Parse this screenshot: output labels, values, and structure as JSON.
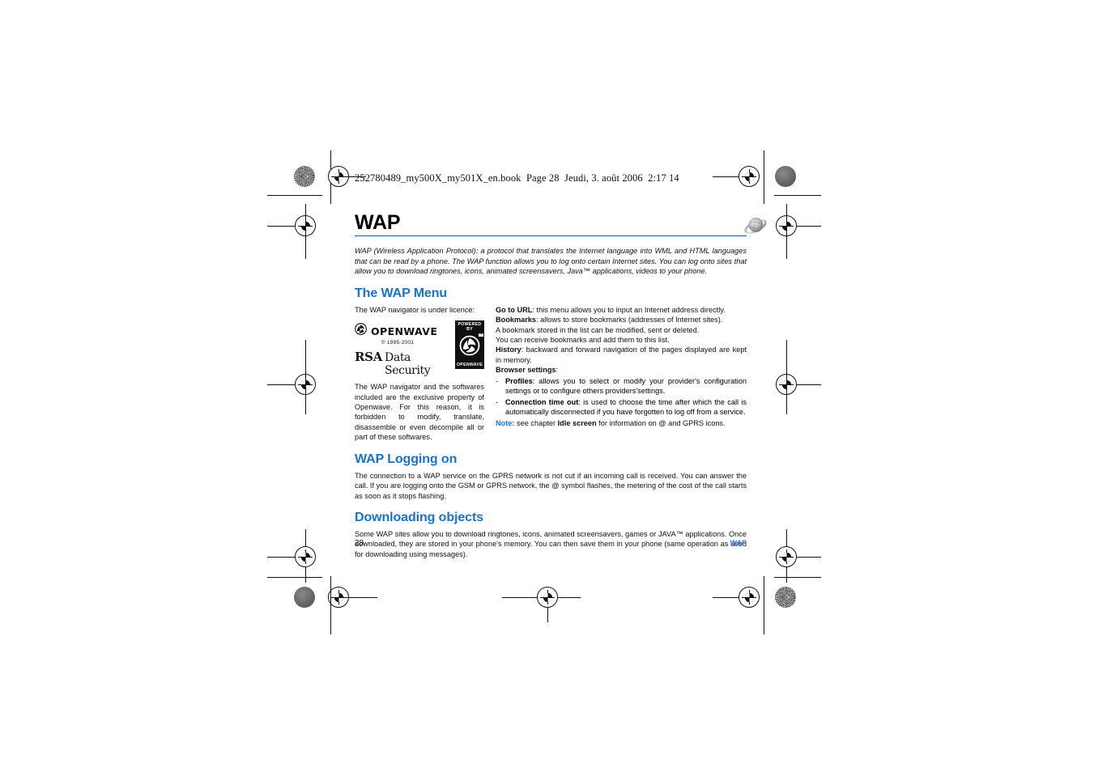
{
  "book_line": "252780489_my500X_my501X_en.book  Page 28  Jeudi, 3. août 2006  2:17 14",
  "header": {
    "title": "WAP",
    "icon": "globe-icon",
    "rule_color": "#0a5bbd"
  },
  "intro": "WAP (Wireless Application Protocol): a protocol that translates the Internet language into WML and HTML languages that can be read by a phone. The WAP function allows you to log onto certain Internet sites. You can log onto sites that allow you to download ringtones, icons, animated screensavers, Java™ applications, videos to your phone.",
  "sections": [
    {
      "id": "wap-menu",
      "heading": "The WAP Menu"
    },
    {
      "id": "wap-logging-on",
      "heading": "WAP Logging on"
    },
    {
      "id": "downloading-objects",
      "heading": "Downloading objects"
    }
  ],
  "wap_menu": {
    "left": {
      "licence_line": "The WAP navigator is under licence:",
      "openwave_word": "OPENWAVE",
      "openwave_copyright": "© 1995-2001",
      "rsa_bold": "RSA",
      "rsa_rest": "Data Security",
      "badge_top": "POWERED BY",
      "badge_tm": "™",
      "badge_bottom": "OPENWAVE",
      "paragraph": "The WAP navigator and the softwares included are the exclusive property of Openwave. For this reason, it is forbidden to modify, translate, disassemble or even decompile all or part of these softwares."
    },
    "right": {
      "items": [
        {
          "term": "Go to URL",
          "sep": ": ",
          "text": "this menu allows you to input an Internet address directly."
        },
        {
          "term": "Bookmarks",
          "sep": ": ",
          "text": "allows to store bookmarks (addresses of Internet sites)."
        }
      ],
      "plain_lines": [
        "A bookmark stored in the list can be modified, sent or deleted.",
        "You can receive bookmarks and add them to this list."
      ],
      "history": {
        "term": "History",
        "sep": ": ",
        "text": "backward and forward navigation of the pages displayed are kept in memory."
      },
      "browser_settings_label": "Browser settings",
      "browser_settings_colon": ":",
      "bullets": [
        {
          "dash": "-",
          "term": "Profiles",
          "sep": ": ",
          "text": "allows you to select or modify your provider's configuration settings or to configure others providers'settings."
        },
        {
          "dash": "-",
          "term": "Connection time out",
          "sep": ": ",
          "text": "is used to choose the time after which the call is automatically disconnected if you have forgotten to log off from a service."
        }
      ],
      "note": {
        "label": "Note:",
        "pre": " see chapter ",
        "bold": "Idle screen",
        "post": " for information on @ and GPRS icons."
      }
    }
  },
  "wap_logging_on": {
    "paragraph": "The connection to a WAP service on the GPRS network is not cut if an incoming call is received. You can answer the call. If you are logging onto the GSM or GPRS network, the @ symbol flashes, the metering of the cost of the call starts as soon as it stops flashing."
  },
  "downloading_objects": {
    "paragraph": "Some WAP sites allow you to download ringtones, icons, animated screensavers, games or JAVA™ applications. Once downloaded, they are stored in your phone's memory. You can then save them in your phone (same operation as used for downloading using messages)."
  },
  "footer": {
    "page_number": "28",
    "running_head": "WAP"
  },
  "colors": {
    "heading_blue": "#1a73c8",
    "rule_blue": "#0a5bbd",
    "runhead_blue": "#2f6fd0",
    "text_black": "#111111"
  }
}
